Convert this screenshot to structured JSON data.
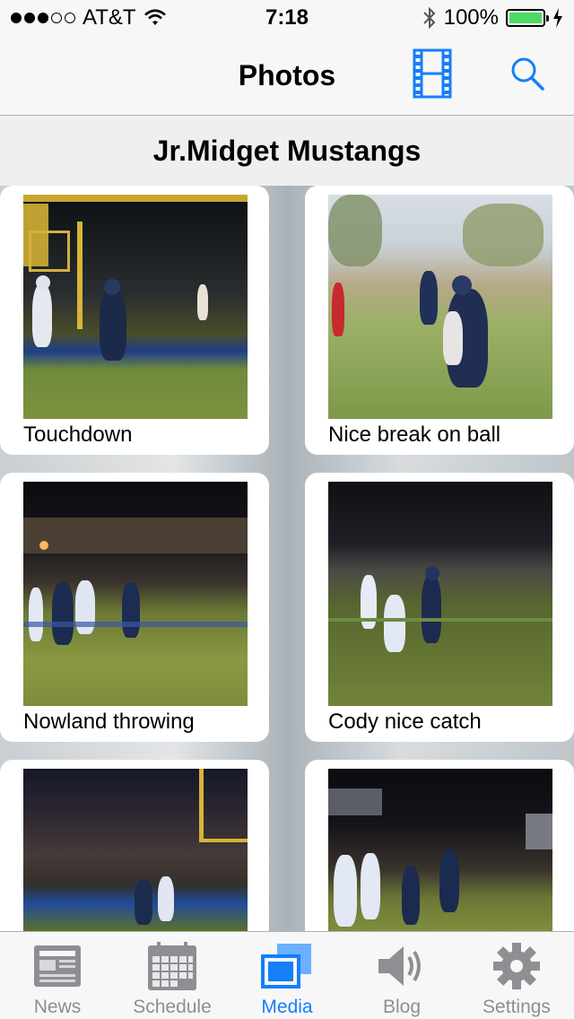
{
  "status_bar": {
    "carrier": "AT&T",
    "signal_bars_filled": 3,
    "signal_bars_total": 5,
    "time": "7:18",
    "battery_percent": "100%",
    "battery_level": 1.0
  },
  "nav": {
    "title": "Photos",
    "film_icon": "film-icon",
    "search_icon": "search-icon",
    "accent_color": "#157efb"
  },
  "section": {
    "title": "Jr.Midget Mustangs"
  },
  "photos": [
    {
      "caption": "Touchdown",
      "scene": "stadium"
    },
    {
      "caption": "Nice break on ball",
      "scene": "day"
    },
    {
      "caption": "Nowland throwing",
      "scene": "night"
    },
    {
      "caption": "Cody nice catch",
      "scene": "night2"
    },
    {
      "caption": "",
      "scene": "dusk"
    },
    {
      "caption": "",
      "scene": "night"
    }
  ],
  "tabs": [
    {
      "label": "News",
      "icon": "newspaper-icon",
      "active": false
    },
    {
      "label": "Schedule",
      "icon": "calendar-icon",
      "active": false
    },
    {
      "label": "Media",
      "icon": "media-icon",
      "active": true
    },
    {
      "label": "Blog",
      "icon": "speaker-icon",
      "active": false
    },
    {
      "label": "Settings",
      "icon": "gear-icon",
      "active": false
    }
  ]
}
